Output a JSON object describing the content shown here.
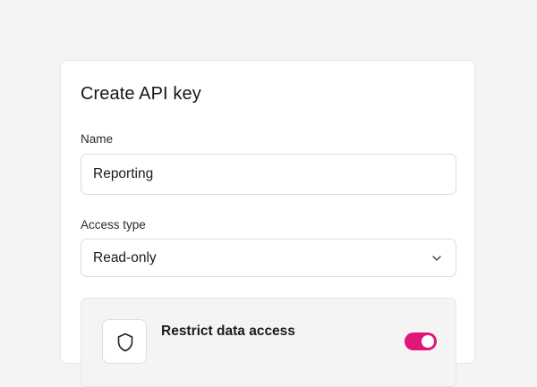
{
  "dialog": {
    "title": "Create API key",
    "name_label": "Name",
    "name_value": "Reporting",
    "access_label": "Access type",
    "access_value": "Read-only",
    "restrict_title": "Restrict data access",
    "restrict_toggle_on": true
  },
  "icons": {
    "access_dropdown": "chevron-down-icon",
    "restrict": "shield-icon"
  },
  "colors": {
    "accent": "#e0167a",
    "background": "#f4f4f4",
    "card": "#ffffff"
  }
}
